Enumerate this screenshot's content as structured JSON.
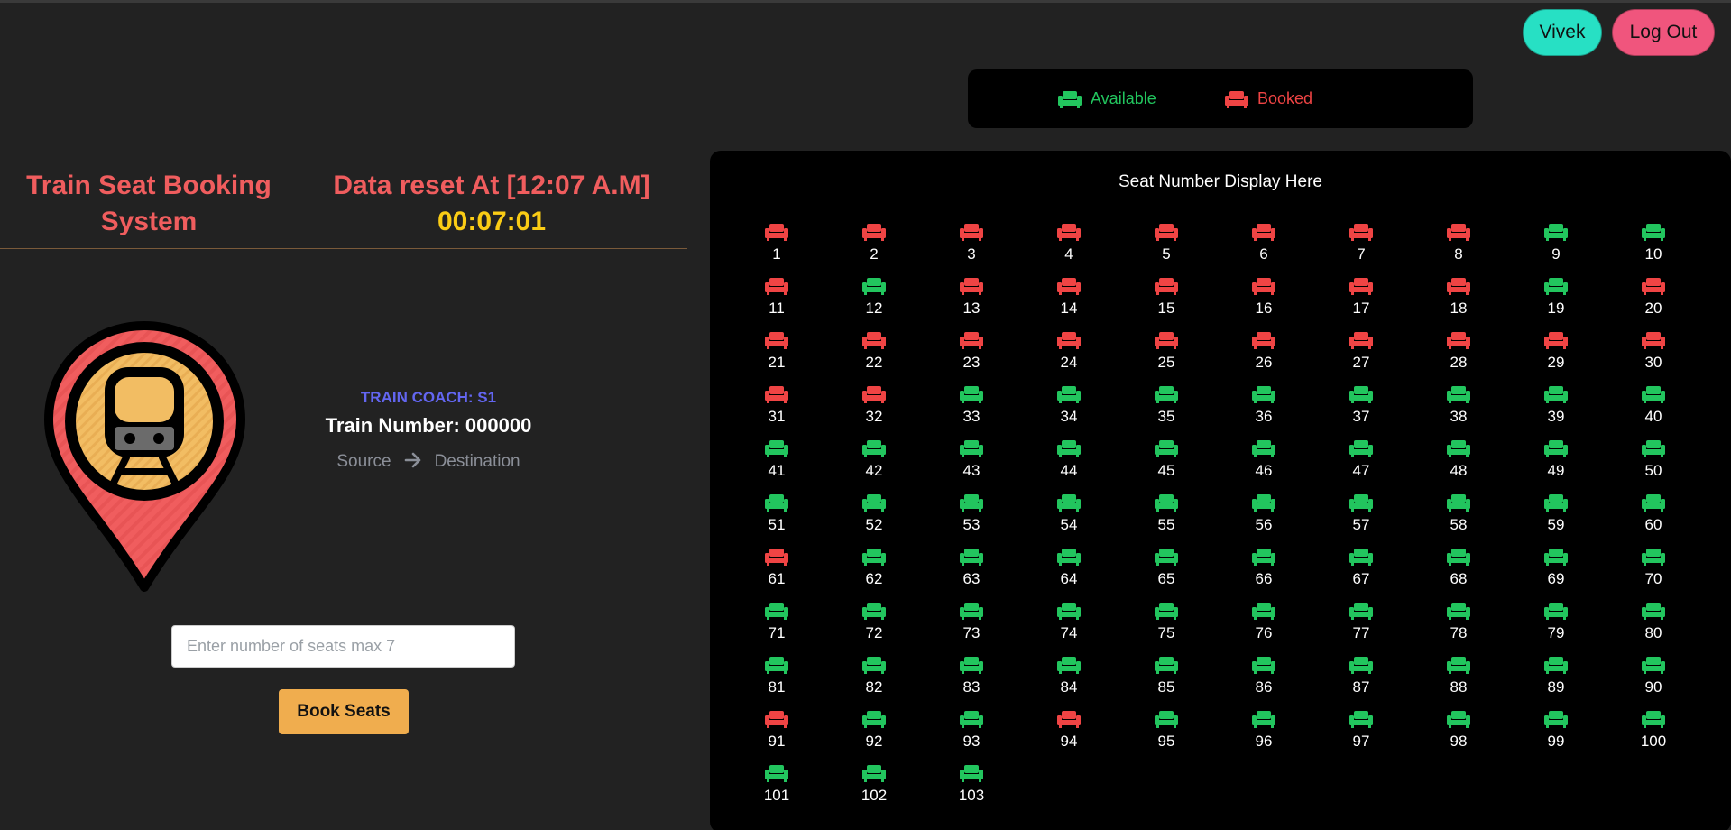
{
  "header": {
    "user_label": "Vivek",
    "logout_label": "Log Out"
  },
  "legend": {
    "available_label": "Available",
    "booked_label": "Booked",
    "available_color": "#22c55e",
    "booked_color": "#ef4444"
  },
  "app": {
    "title": "Train Seat Booking System",
    "reset_label": "Data reset At [12:07 A.M]",
    "timer": "00:07:01",
    "train_icon": "train-location-pin-icon"
  },
  "train": {
    "coach": "TRAIN COACH: S1",
    "number": "Train Number: 000000",
    "source": "Source",
    "destination": "Destination",
    "arrow_icon": "arrow-right-icon"
  },
  "booking": {
    "placeholder": "Enter number of seats max 7",
    "value": "",
    "button_label": "Book Seats"
  },
  "seats": {
    "title": "Seat Number Display Here",
    "seat_icon": "sofa-icon",
    "booked": [
      1,
      2,
      3,
      4,
      5,
      6,
      7,
      8,
      11,
      13,
      14,
      15,
      16,
      17,
      18,
      20,
      21,
      22,
      23,
      24,
      25,
      26,
      27,
      28,
      29,
      30,
      31,
      32,
      61,
      91,
      94
    ],
    "total": 103
  }
}
